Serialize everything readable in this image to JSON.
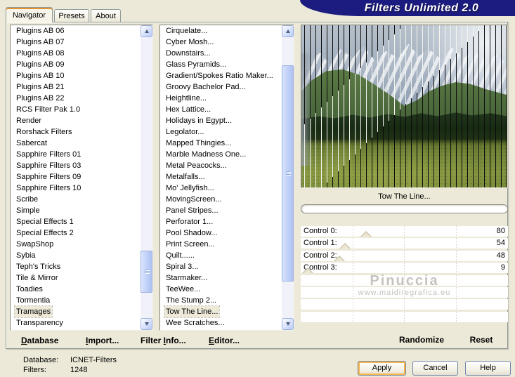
{
  "window": {
    "title": "Filters Unlimited 2.0"
  },
  "tabs": [
    {
      "label": "Navigator",
      "active": true
    },
    {
      "label": "Presets",
      "active": false
    },
    {
      "label": "About",
      "active": false
    }
  ],
  "left_list": {
    "items": [
      "Plugins AB 06",
      "Plugins AB 07",
      "Plugins AB 08",
      "Plugins AB 09",
      "Plugins AB 10",
      "Plugins AB 21",
      "Plugins AB 22",
      "RCS Filter Pak 1.0",
      "Render",
      "Rorshack Filters",
      "Sabercat",
      "Sapphire Filters 01",
      "Sapphire Filters 03",
      "Sapphire Filters 09",
      "Sapphire Filters 10",
      "Scribe",
      "Simple",
      "Special Effects 1",
      "Special Effects 2",
      "SwapShop",
      "Sybia",
      "Teph's Tricks",
      "Tile & Mirror",
      "Toadies",
      "Tormentia",
      "Tramages",
      "Transparency"
    ],
    "selected": "Tramages"
  },
  "filter_list": {
    "items": [
      "Cirquelate...",
      "Cyber Mosh...",
      "Downstairs...",
      "Glass Pyramids...",
      "Gradient/Spokes Ratio Maker...",
      "Groovy Bachelor Pad...",
      "Heightline...",
      "Hex Lattice...",
      "Holidays in Egypt...",
      "Legolator...",
      "Mapped Thingies...",
      "Marble Madness One...",
      "Metal Peacocks...",
      "Metalfalls...",
      "Mo' Jellyfish...",
      "MovingScreen...",
      "Panel Stripes...",
      "Perforator 1...",
      "Pool Shadow...",
      "Print Screen...",
      "Quilt......",
      "Spiral 3...",
      "Starmaker...",
      "TeeWee...",
      "The Stump 2...",
      "Tow The Line...",
      "Wee Scratches..."
    ],
    "selected": "Tow The Line..."
  },
  "preview": {
    "filter_name": "Tow The Line..."
  },
  "controls": [
    {
      "label": "Control 0:",
      "value": 80
    },
    {
      "label": "Control 1:",
      "value": 54
    },
    {
      "label": "Control 2:",
      "value": 48
    },
    {
      "label": "Control 3:",
      "value": 9
    }
  ],
  "control_range_max": 255,
  "empty_rows": 4,
  "watermark": {
    "line1": "Pinuccia",
    "line2": "www.maidiregrafica.eu"
  },
  "toolbar": {
    "database": {
      "pre": "",
      "key": "D",
      "post": "atabase"
    },
    "import": {
      "pre": "",
      "key": "I",
      "post": "mport..."
    },
    "filter_info": {
      "pre": "Filter ",
      "key": "I",
      "post": "nfo..."
    },
    "editor": {
      "pre": "",
      "key": "E",
      "post": "ditor..."
    }
  },
  "actions": {
    "randomize": "Randomize",
    "reset": "Reset"
  },
  "status": {
    "database_label": "Database:",
    "database_value": "ICNET-Filters",
    "filters_label": "Filters:",
    "filters_value": "1248"
  },
  "buttons": {
    "apply": "Apply",
    "cancel": "Cancel",
    "help": "Help"
  },
  "colors": {
    "banner": "#1b1b80",
    "tab_accent": "#e5932f",
    "selection": "#ece9d8"
  }
}
